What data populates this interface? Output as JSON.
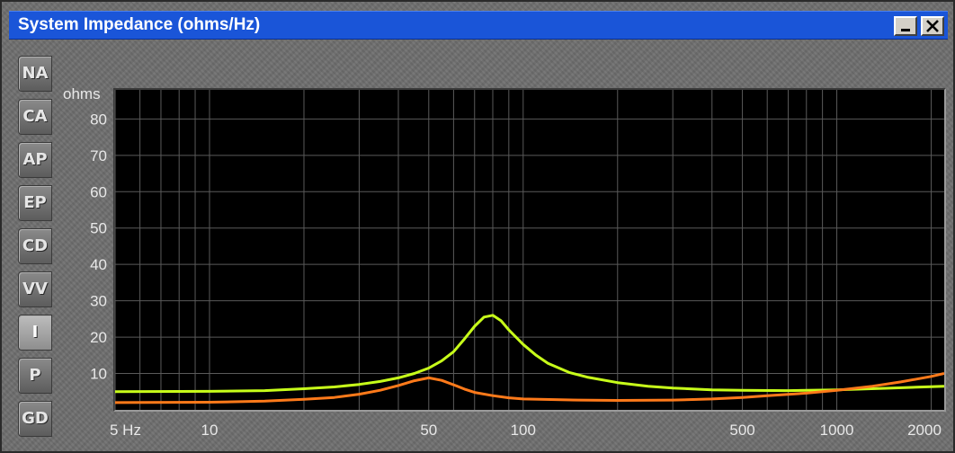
{
  "window": {
    "title": "System Impedance (ohms/Hz)",
    "minimize_label": "_",
    "close_label": "X"
  },
  "side_tabs": [
    {
      "label": "NA",
      "active": false
    },
    {
      "label": "CA",
      "active": false
    },
    {
      "label": "AP",
      "active": false
    },
    {
      "label": "EP",
      "active": false
    },
    {
      "label": "CD",
      "active": false
    },
    {
      "label": "VV",
      "active": false
    },
    {
      "label": "I",
      "active": true
    },
    {
      "label": "P",
      "active": false
    },
    {
      "label": "GD",
      "active": false
    }
  ],
  "colors": {
    "titlebar": "#1a55d8",
    "plot_bg": "#000000",
    "grid": "#5a5a5a",
    "series_1": "#c8ff1a",
    "series_2": "#ff7a1a"
  },
  "chart_data": {
    "type": "line",
    "title": "System Impedance (ohms/Hz)",
    "ylabel": "ohms",
    "xlabel": "",
    "x_scale": "log",
    "xlim": [
      5,
      2200
    ],
    "ylim": [
      0,
      88
    ],
    "grid": true,
    "y_ticks": [
      10,
      20,
      30,
      40,
      50,
      60,
      70,
      80
    ],
    "x_ticks": [
      {
        "value": 5,
        "label": "5 Hz"
      },
      {
        "value": 10,
        "label": "10"
      },
      {
        "value": 50,
        "label": "50"
      },
      {
        "value": 100,
        "label": "100"
      },
      {
        "value": 500,
        "label": "500"
      },
      {
        "value": 1000,
        "label": "1000"
      },
      {
        "value": 2000,
        "label": "2000"
      }
    ],
    "series": [
      {
        "color": "#c8ff1a",
        "points": [
          [
            5,
            5.0
          ],
          [
            10,
            5.1
          ],
          [
            15,
            5.3
          ],
          [
            20,
            5.8
          ],
          [
            25,
            6.3
          ],
          [
            30,
            7.0
          ],
          [
            35,
            7.8
          ],
          [
            40,
            8.8
          ],
          [
            45,
            10.0
          ],
          [
            50,
            11.5
          ],
          [
            55,
            13.5
          ],
          [
            60,
            16.0
          ],
          [
            65,
            19.5
          ],
          [
            70,
            23.0
          ],
          [
            75,
            25.5
          ],
          [
            80,
            26.0
          ],
          [
            85,
            24.5
          ],
          [
            90,
            22.0
          ],
          [
            100,
            18.0
          ],
          [
            110,
            15.0
          ],
          [
            120,
            12.8
          ],
          [
            140,
            10.3
          ],
          [
            160,
            9.0
          ],
          [
            200,
            7.5
          ],
          [
            250,
            6.5
          ],
          [
            300,
            6.0
          ],
          [
            400,
            5.5
          ],
          [
            500,
            5.4
          ],
          [
            700,
            5.3
          ],
          [
            1000,
            5.5
          ],
          [
            1500,
            6.0
          ],
          [
            2200,
            6.5
          ]
        ]
      },
      {
        "color": "#ff7a1a",
        "points": [
          [
            5,
            2.0
          ],
          [
            10,
            2.1
          ],
          [
            15,
            2.4
          ],
          [
            20,
            2.9
          ],
          [
            25,
            3.4
          ],
          [
            30,
            4.3
          ],
          [
            35,
            5.4
          ],
          [
            40,
            6.7
          ],
          [
            45,
            8.0
          ],
          [
            50,
            8.8
          ],
          [
            55,
            8.1
          ],
          [
            60,
            6.9
          ],
          [
            65,
            5.7
          ],
          [
            70,
            4.8
          ],
          [
            80,
            3.9
          ],
          [
            90,
            3.3
          ],
          [
            100,
            3.0
          ],
          [
            150,
            2.7
          ],
          [
            200,
            2.6
          ],
          [
            300,
            2.7
          ],
          [
            400,
            3.0
          ],
          [
            500,
            3.4
          ],
          [
            600,
            3.9
          ],
          [
            800,
            4.6
          ],
          [
            1000,
            5.4
          ],
          [
            1300,
            6.5
          ],
          [
            1600,
            7.7
          ],
          [
            2000,
            9.2
          ],
          [
            2200,
            10.0
          ]
        ]
      }
    ]
  }
}
